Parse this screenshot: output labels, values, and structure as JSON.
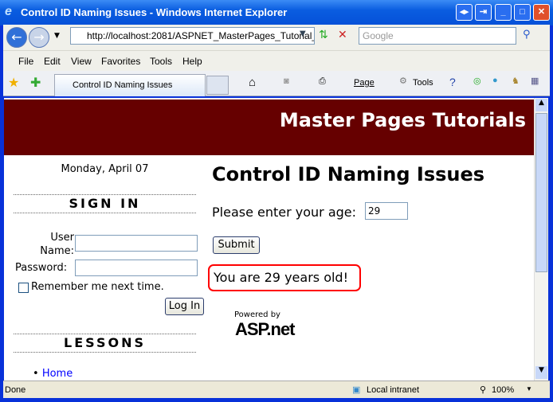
{
  "window": {
    "title": "Control ID Naming Issues - Windows Internet Explorer"
  },
  "address": {
    "url": "http://localhost:2081/ASPNET_MasterPages_Tutorial_",
    "search_placeholder": "Google"
  },
  "menu": [
    "File",
    "Edit",
    "View",
    "Favorites",
    "Tools",
    "Help"
  ],
  "tab": {
    "label": "Control ID Naming Issues"
  },
  "toolbar": {
    "page": "Page",
    "tools": "Tools"
  },
  "page": {
    "header": "Master Pages Tutorials",
    "date": "Monday, April 07",
    "signin": {
      "heading": "SIGN IN",
      "user_label": "User Name:",
      "password_label": "Password:",
      "remember": "Remember me next time.",
      "login": "Log In"
    },
    "lessons": {
      "heading": "LESSONS",
      "items": [
        "Home"
      ]
    },
    "title": "Control ID Naming Issues",
    "age_prompt": "Please enter your age:",
    "age_value": "29",
    "submit": "Submit",
    "result": "You are 29 years old!",
    "powered_by": "Powered by",
    "asp_logo": "ASP.net"
  },
  "status": {
    "text": "Done",
    "zone": "Local intranet",
    "zoom": "100%"
  },
  "colors": {
    "header_bg": "#660000",
    "highlight": "#ff0000",
    "link": "#0000ff"
  }
}
